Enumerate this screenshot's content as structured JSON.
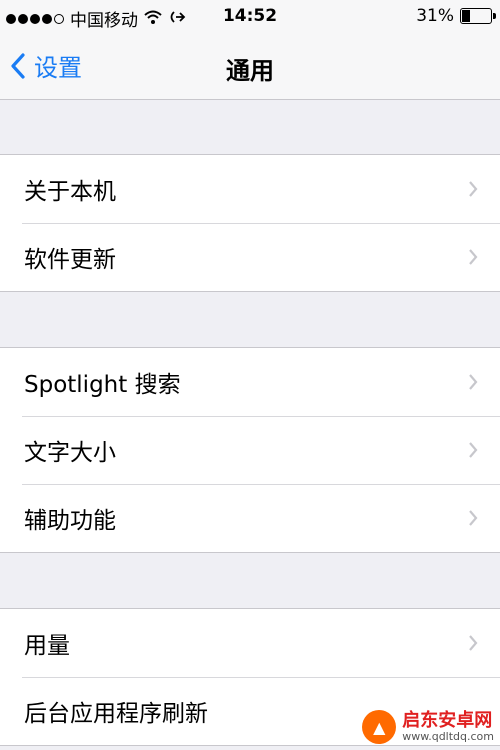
{
  "status_bar": {
    "carrier": "中国移动",
    "time": "14:52",
    "battery_percent": "31%",
    "battery_level": 0.31
  },
  "nav": {
    "back_label": "设置",
    "title": "通用"
  },
  "groups": [
    {
      "items": [
        "关于本机",
        "软件更新"
      ]
    },
    {
      "items": [
        "Spotlight 搜索",
        "文字大小",
        "辅助功能"
      ]
    },
    {
      "items": [
        "用量",
        "后台应用程序刷新"
      ]
    }
  ],
  "watermark": {
    "name": "启东安卓网",
    "url": "www.qdltdq.com"
  },
  "colors": {
    "accent": "#1a7cf4",
    "background": "#efeff4"
  }
}
